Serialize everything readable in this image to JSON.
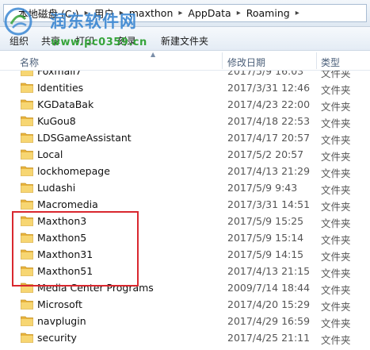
{
  "address_bar": {
    "crumbs": [
      "本地磁盘 (C:)",
      "用户",
      "maxthon",
      "AppData",
      "Roaming"
    ]
  },
  "watermark": {
    "title": "润东软件网",
    "url": "www.pc0359.cn"
  },
  "toolbar": {
    "organize_label": "组织",
    "share_label": "共享",
    "print_label": "打印",
    "burn_label": "刻录",
    "new_folder_label": "新建文件夹"
  },
  "columns": {
    "name": "名称",
    "date": "修改日期",
    "type": "类型"
  },
  "files": [
    {
      "name": "Foxmail7",
      "date": "2017/5/9 16:03",
      "type": "文件夹"
    },
    {
      "name": "Identities",
      "date": "2017/3/31 12:46",
      "type": "文件夹"
    },
    {
      "name": "KGDataBak",
      "date": "2017/4/23 22:00",
      "type": "文件夹"
    },
    {
      "name": "KuGou8",
      "date": "2017/4/18 22:53",
      "type": "文件夹"
    },
    {
      "name": "LDSGameAssistant",
      "date": "2017/4/17 20:57",
      "type": "文件夹"
    },
    {
      "name": "Local",
      "date": "2017/5/2 20:57",
      "type": "文件夹"
    },
    {
      "name": "lockhomepage",
      "date": "2017/4/13 21:29",
      "type": "文件夹"
    },
    {
      "name": "Ludashi",
      "date": "2017/5/9 9:43",
      "type": "文件夹"
    },
    {
      "name": "Macromedia",
      "date": "2017/3/31 14:51",
      "type": "文件夹"
    },
    {
      "name": "Maxthon3",
      "date": "2017/5/9 15:25",
      "type": "文件夹"
    },
    {
      "name": "Maxthon5",
      "date": "2017/5/9 15:14",
      "type": "文件夹"
    },
    {
      "name": "Maxthon31",
      "date": "2017/5/9 14:15",
      "type": "文件夹"
    },
    {
      "name": "Maxthon51",
      "date": "2017/4/13 21:15",
      "type": "文件夹"
    },
    {
      "name": "Media Center Programs",
      "date": "2009/7/14 18:44",
      "type": "文件夹"
    },
    {
      "name": "Microsoft",
      "date": "2017/4/20 15:29",
      "type": "文件夹"
    },
    {
      "name": "navplugin",
      "date": "2017/4/29 16:59",
      "type": "文件夹"
    },
    {
      "name": "security",
      "date": "2017/4/25 21:11",
      "type": "文件夹"
    }
  ],
  "colors": {
    "highlight_border": "#d9282f",
    "folder_fill": "#f2c756",
    "watermark_blue": "#3b87d2",
    "watermark_green": "#36a43a"
  },
  "icons": {
    "folder": "folder-icon",
    "breadcrumb_separator": "chevron-right-icon"
  }
}
